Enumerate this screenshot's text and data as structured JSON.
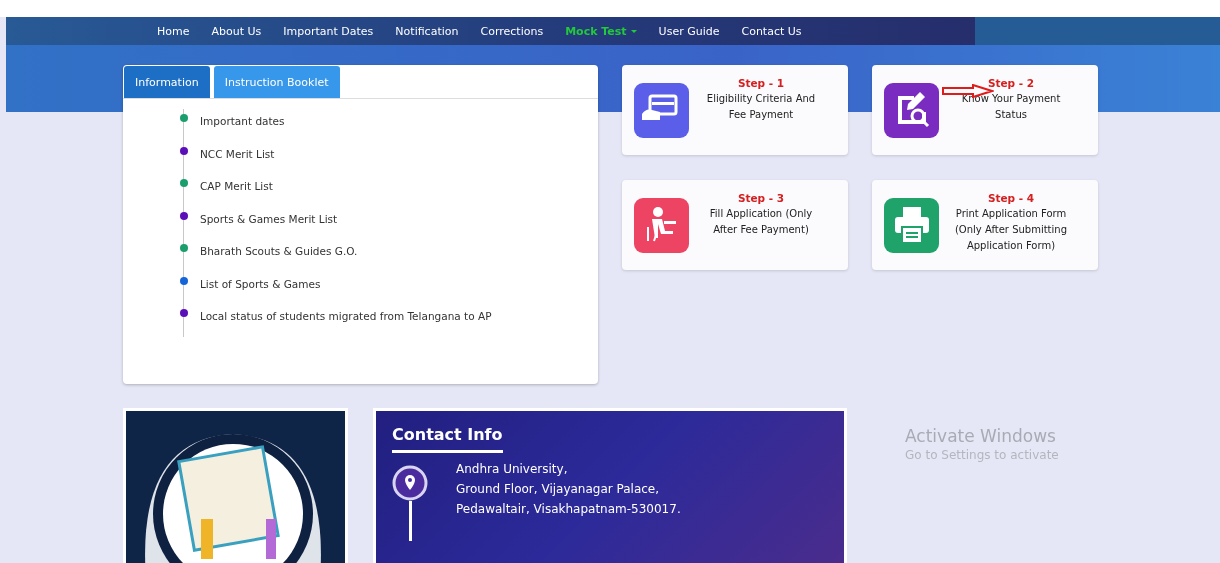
{
  "nav": {
    "items": [
      {
        "label": "Home",
        "selected": false,
        "dropdown": false
      },
      {
        "label": "About Us",
        "selected": false,
        "dropdown": false
      },
      {
        "label": "Important Dates",
        "selected": false,
        "dropdown": false
      },
      {
        "label": "Notification",
        "selected": false,
        "dropdown": false
      },
      {
        "label": "Corrections",
        "selected": false,
        "dropdown": false
      },
      {
        "label": "Mock Test",
        "selected": true,
        "dropdown": true
      },
      {
        "label": "User Guide",
        "selected": false,
        "dropdown": false
      },
      {
        "label": "Contact Us",
        "selected": false,
        "dropdown": false
      }
    ]
  },
  "info_panel": {
    "tabs": [
      {
        "label": "Information",
        "selected": true
      },
      {
        "label": "Instruction Booklet",
        "selected": false
      }
    ],
    "items": [
      {
        "label": "Important dates",
        "color": "#1a9e6e"
      },
      {
        "label": "NCC Merit List",
        "color": "#5b0fb8"
      },
      {
        "label": "CAP Merit List",
        "color": "#1a9e6e"
      },
      {
        "label": "Sports & Games Merit List",
        "color": "#5b0fb8"
      },
      {
        "label": "Bharath Scouts & Guides G.O.",
        "color": "#1a9e6e"
      },
      {
        "label": "List of Sports & Games",
        "color": "#1565d8"
      },
      {
        "label": "Local status of students migrated from Telangana to AP",
        "color": "#5b0fb8"
      }
    ]
  },
  "steps": [
    {
      "kind": "card",
      "step": "Step - 1",
      "text": "Eligibility Criteria And Fee Payment",
      "color": "#5a5ee8",
      "annotated": false
    },
    {
      "kind": "search",
      "step": "Step - 2",
      "text": "Know Your Payment Status",
      "color": "#7a2bc0",
      "annotated": true
    },
    {
      "kind": "person",
      "step": "Step - 3",
      "text": "Fill Application (Only After Fee Payment)",
      "color": "#ee4463",
      "annotated": false
    },
    {
      "kind": "printer",
      "step": "Step - 4",
      "text": "Print Application Form (Only After Submitting Application Form)",
      "color": "#1fa36a",
      "annotated": false
    }
  ],
  "contact": {
    "title": "Contact Info",
    "address": [
      "Andhra University,",
      "Ground Floor, Vijayanagar Palace,",
      "Pedawaltair, Visakhapatnam-530017."
    ]
  },
  "os_notice": {
    "title": "Activate Windows",
    "text": "Go to Settings to activate"
  }
}
